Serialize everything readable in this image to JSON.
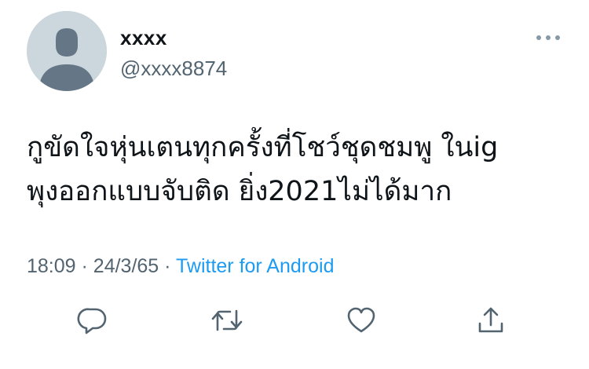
{
  "tweet": {
    "display_name": "xxxx",
    "handle": "@xxxx8874",
    "text_lines": [
      "กูขัดใจหุ่นเตนทุกครั้งที่โชว์ชุดชมพู ในig",
      "พุงออกแบบจับติด ยิ่ง2021ไม่ได้มาก"
    ],
    "time": "18:09",
    "separator": "·",
    "date": "24/3/65",
    "source": "Twitter for Android"
  },
  "icons": {
    "avatar": "default-avatar-icon",
    "more": "more-dots-icon",
    "reply": "reply-icon",
    "retweet": "retweet-icon",
    "like": "heart-icon",
    "share": "share-icon"
  },
  "colors": {
    "text": "#0f1419",
    "secondary": "#536471",
    "accent": "#1d9bf0",
    "avatar_bg": "#ccd6dd",
    "avatar_fg": "#657786"
  }
}
